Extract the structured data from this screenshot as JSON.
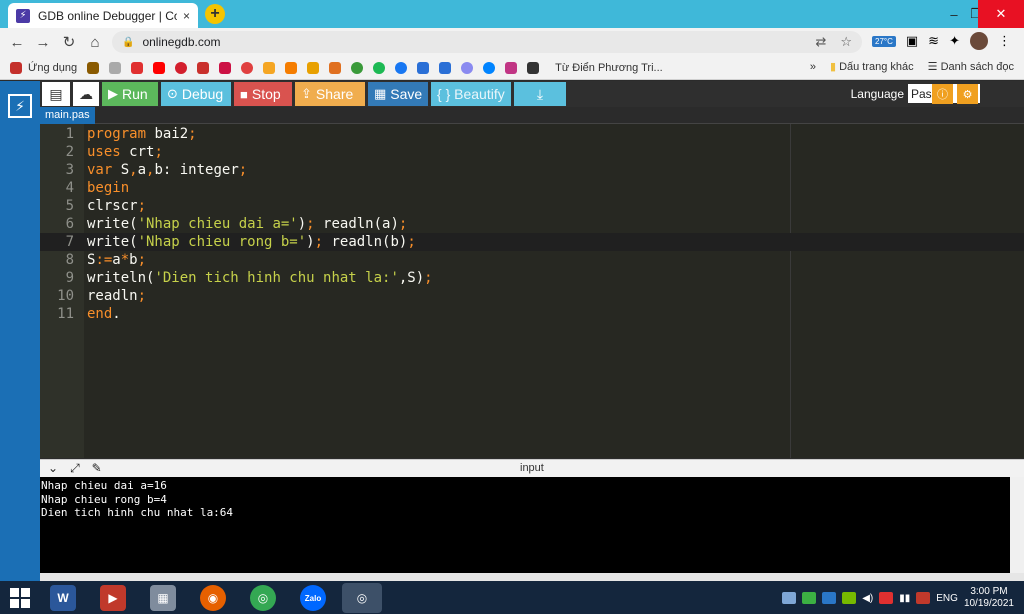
{
  "browser": {
    "tab_title": "GDB online Debugger | Compiler",
    "tab_close": "×",
    "newtab_label": "+",
    "favicon": "⚡",
    "url": "onlinegdb.com",
    "minimize": "–",
    "restore": "❐",
    "close": "✕"
  },
  "bookmarks": {
    "apps_label": "Ứng dụng",
    "dictionary_label": "Từ Điển Phương Tri...",
    "more": "»",
    "other_label": "Dấu trang khác",
    "reading_list_label": "Danh sách đọc"
  },
  "weather": {
    "temp": "27°C"
  },
  "toolbar": {
    "run": "Run",
    "debug": "Debug",
    "stop": "Stop",
    "share": "Share",
    "save": "Save",
    "beautify": "{ } Beautify",
    "language_label": "Language",
    "language_value": "Pascal"
  },
  "editor": {
    "file_name": "main.pas",
    "lines": [
      {
        "n": "1"
      },
      {
        "n": "2"
      },
      {
        "n": "3"
      },
      {
        "n": "4"
      },
      {
        "n": "5"
      },
      {
        "n": "6"
      },
      {
        "n": "7"
      },
      {
        "n": "8"
      },
      {
        "n": "9"
      },
      {
        "n": "10"
      },
      {
        "n": "11"
      }
    ],
    "tokens": {
      "l1_kw": "program",
      "l1_rest": " bai2",
      "l1_p": ";",
      "l2_kw": "uses",
      "l2_rest": " crt",
      "l2_p": ";",
      "l3_kw": "var",
      "l3_a": " S",
      "l3_c1": ",",
      "l3_b": "a",
      "l3_c2": ",",
      "l3_d": "b: integer",
      "l3_p": ";",
      "l4_kw": "begin",
      "l5_a": "clrscr",
      "l5_p": ";",
      "l6_a": "write(",
      "l6_s": "'Nhap chieu dai a='",
      "l6_b": ")",
      "l6_p1": ";",
      "l6_c": " readln(a)",
      "l6_p2": ";",
      "l7_a": "write(",
      "l7_s": "'Nhap chieu rong b='",
      "l7_b": ")",
      "l7_p1": ";",
      "l7_c": " readln(b)",
      "l7_p2": ";",
      "l8_a": "S",
      "l8_op": ":=",
      "l8_b": "a",
      "l8_op2": "*",
      "l8_c": "b",
      "l8_p": ";",
      "l9_a": "writeln(",
      "l9_s": "'Dien tich hinh chu nhat la:'",
      "l9_b": ",S)",
      "l9_p": ";",
      "l10_a": "readln",
      "l10_p": ";",
      "l11_kw": "end",
      "l11_p": "."
    }
  },
  "io_panel": {
    "title": "input",
    "output_lines": [
      "Nhap chieu dai a=16",
      "Nhap chieu rong b=4",
      "Dien tich hinh chu nhat la:64"
    ]
  },
  "taskbar": {
    "lang": "ENG",
    "time": "3:00 PM",
    "date": "10/19/2021"
  }
}
